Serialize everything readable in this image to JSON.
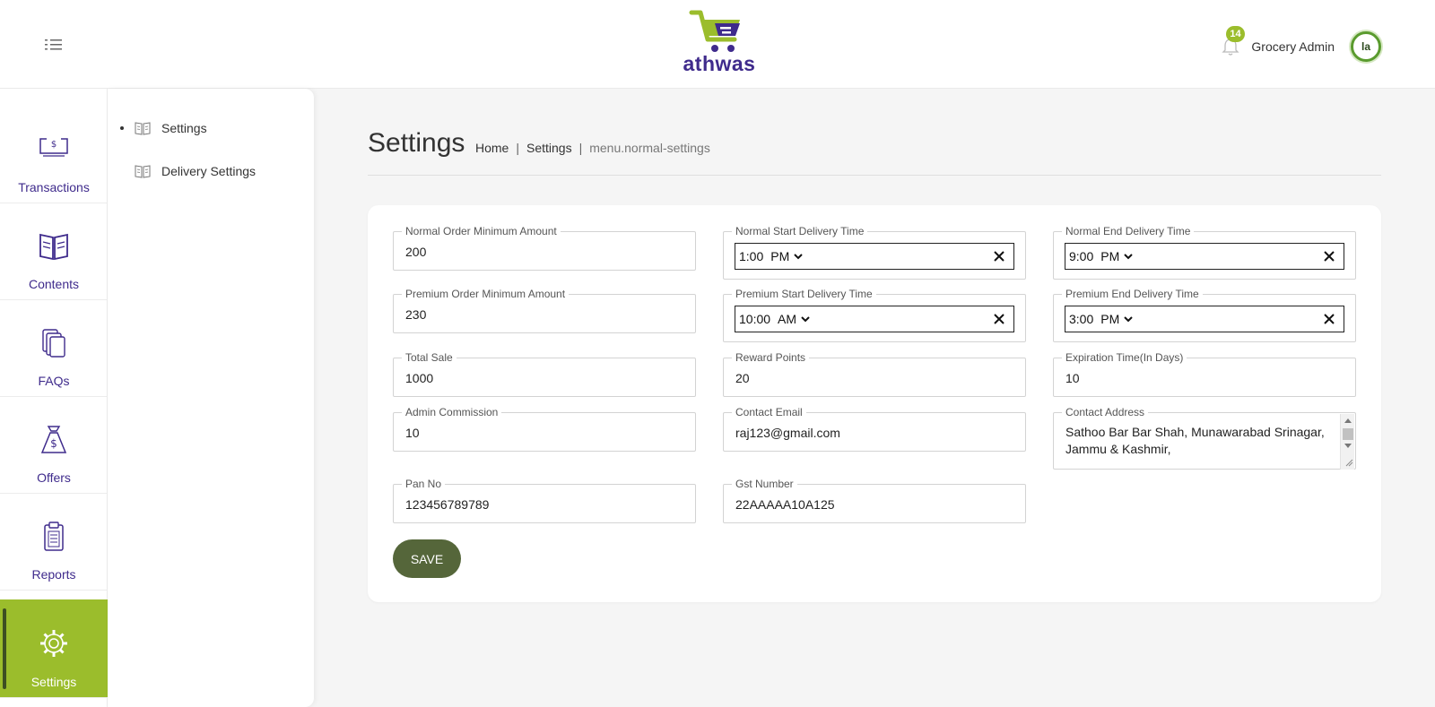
{
  "header": {
    "brand": "athwas",
    "notification_count": "14",
    "user_name": "Grocery Admin",
    "avatar_initials": "la"
  },
  "rail": {
    "items": [
      {
        "label": "Transactions",
        "icon": "money-icon"
      },
      {
        "label": "Contents",
        "icon": "book-icon"
      },
      {
        "label": "FAQs",
        "icon": "books-icon"
      },
      {
        "label": "Offers",
        "icon": "money-bag-icon"
      },
      {
        "label": "Reports",
        "icon": "clipboard-icon"
      },
      {
        "label": "Settings",
        "icon": "gear-icon",
        "active": true
      }
    ]
  },
  "submenu": {
    "items": [
      {
        "label": "Settings",
        "active": true
      },
      {
        "label": "Delivery Settings"
      }
    ]
  },
  "page": {
    "title": "Settings",
    "breadcrumb": [
      "Home",
      "Settings",
      "menu.normal-settings"
    ]
  },
  "form": {
    "normal_min_amount": {
      "label": "Normal Order Minimum Amount",
      "value": "200"
    },
    "normal_start_time": {
      "label": "Normal Start Delivery Time",
      "time": "1:00",
      "ampm": "PM"
    },
    "normal_end_time": {
      "label": "Normal End Delivery Time",
      "time": "9:00",
      "ampm": "PM"
    },
    "premium_min_amount": {
      "label": "Premium Order Minimum Amount",
      "value": "230"
    },
    "premium_start_time": {
      "label": "Premium Start Delivery Time",
      "time": "10:00",
      "ampm": "AM"
    },
    "premium_end_time": {
      "label": "Premium End Delivery Time",
      "time": "3:00",
      "ampm": "PM"
    },
    "total_sale": {
      "label": "Total Sale",
      "value": "1000"
    },
    "reward_points": {
      "label": "Reward Points",
      "value": "20"
    },
    "expiration_time": {
      "label": "Expiration Time(In Days)",
      "value": "10"
    },
    "admin_commission": {
      "label": "Admin Commission",
      "value": "10"
    },
    "contact_email": {
      "label": "Contact Email",
      "value": "raj123@gmail.com"
    },
    "contact_address": {
      "label": "Contact Address",
      "value": "Sathoo Bar Bar Shah, Munawarabad Srinagar, Jammu & Kashmir,"
    },
    "pan_no": {
      "label": "Pan No",
      "value": "123456789789"
    },
    "gst_number": {
      "label": "Gst Number",
      "value": "22AAAAA10A125"
    },
    "save_label": "SAVE"
  },
  "colors": {
    "brand_purple": "#3f2b8c",
    "accent_green": "#9bbd2c",
    "save_button": "#55663a"
  }
}
